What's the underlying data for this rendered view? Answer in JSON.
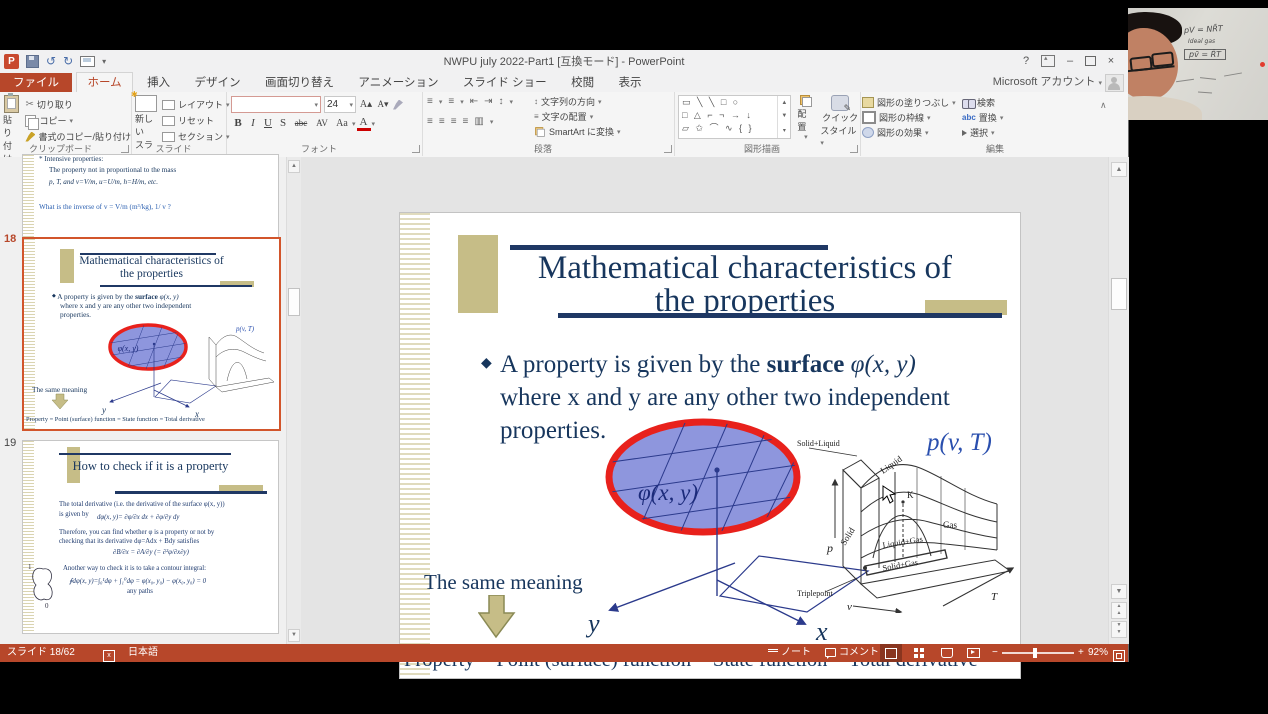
{
  "window": {
    "title": "NWPU july 2022-Part1 [互換モード] - PowerPoint",
    "account": "Microsoft アカウント"
  },
  "icons": {
    "caret": "▾",
    "up": "▲",
    "down": "▼",
    "minus": "−",
    "plus": "+",
    "undo": "↺",
    "redo": "↻",
    "help": "?",
    "min": "–",
    "close": "×",
    "collapse": "∧",
    "cut": "✂",
    "bold": "B",
    "italic": "I",
    "underline": "U",
    "strike": "S",
    "abc": "abc",
    "av": "AV",
    "aa": "Aa",
    "fontcolor": "A",
    "grow": "A▴",
    "shrink": "A▾",
    "eq": "≡",
    "indent_l": "⇤",
    "indent_r": "⇥",
    "spacing": "↕",
    "columns": "▥",
    "dots": "⁞",
    "shapes_r1": "▭ ╲ ╲ □ ○",
    "shapes_r2": "□ △ ⌐ ¬ → ↓",
    "shapes_r3": "▱ ✩ ⌒ ∿ { }"
  },
  "tabs": [
    {
      "label": "ファイル"
    },
    {
      "label": "ホーム"
    },
    {
      "label": "挿入"
    },
    {
      "label": "デザイン"
    },
    {
      "label": "画面切り替え"
    },
    {
      "label": "アニメーション"
    },
    {
      "label": "スライド ショー"
    },
    {
      "label": "校閲"
    },
    {
      "label": "表示"
    }
  ],
  "ribbon": {
    "clipboard": {
      "label": "クリップボード",
      "paste": "貼り付け",
      "cut": "切り取り",
      "copy": "コピー",
      "format_painter": "書式のコピー/貼り付け"
    },
    "slides": {
      "label": "スライド",
      "new1": "新しい",
      "new2": "スライド",
      "layout": "レイアウト",
      "reset": "リセット",
      "section": "セクション"
    },
    "font": {
      "label": "フォント",
      "size": "24"
    },
    "paragraph": {
      "label": "段落",
      "direction": "文字列の方向",
      "align_text": "文字の配置",
      "smartart": "SmartArt に変換"
    },
    "drawing": {
      "label": "図形描画",
      "arrange": "配置",
      "quick1": "クイック",
      "quick2": "スタイル",
      "fill": "図形の塗りつぶし",
      "outline": "図形の枠線",
      "effects": "図形の効果"
    },
    "editing": {
      "label": "編集",
      "find": "検索",
      "replace": "置換",
      "select": "選択"
    }
  },
  "thumbnails": {
    "partial": {
      "l0": "* Intensive properties:",
      "l1": "The property not in proportional to the mass",
      "l2": "p, T, and v=V/m, u=U/m, h=H/m, etc.",
      "l3": "What is the inverse of v = V/m  (m³/kg), 1/ v ?"
    },
    "s18": {
      "number": "18"
    },
    "s19": {
      "number": "19",
      "title": "How to check if it is a property",
      "l1": "The total derivative (i.e. the derivative of the surface φ(x, y))",
      "l2": "is given by",
      "f1": "dφ(x, y)= ∂φ/∂x dx + ∂φ/∂y dy",
      "l3": "Therefore, you can find whether φ is a property or not by",
      "l4": "checking that its derivative   dφ=Adx + Bdy   satisfies",
      "f2": "∂B/∂x = ∂A/∂y (= ∂²φ/∂x∂y)",
      "l5": "Another way to check it is to take a contour integral:",
      "f3": "∮dφ(x, y)=∫₀¹dφ + ∫₁⁰dφ = φ(x₀, y₀) − φ(x₀, y₀) = 0",
      "f3b": "any paths",
      "c1": "1",
      "c0": "0"
    }
  },
  "slide": {
    "title1": "Mathematical characteristics of",
    "title2": "the properties",
    "bullet_glyph": "◆",
    "b1a": "A property is given by the ",
    "b1b": "surface",
    "b1c": " φ(x, y)",
    "b2": "where x and y are any other two independent",
    "b3": "properties.",
    "ellipse_label": "φ(x, y)",
    "same": "The same meaning",
    "x": "x",
    "y": "y",
    "bottom": "Property = Point (surface) function = State function = Total derivative",
    "pvt": {
      "label": "p(v, T)",
      "solid_liquid": "Solid+Liquid",
      "liquid": "Liquid",
      "k": "K",
      "gas": "Gas",
      "liquid_gas": "Liquid+Gas",
      "solid_gas": "Solid+Gas",
      "solid": "Solid",
      "p": "p",
      "triple": "Triplepoint",
      "v": "v",
      "t": "T"
    }
  },
  "statusbar": {
    "slide": "スライド 18/62",
    "lang": "日本語",
    "notes": "ノート",
    "comments": "コメント",
    "zoom": "92%"
  },
  "webcam": {
    "b1": "pV = NR̄T",
    "b2": "Ideal gas",
    "b3": "pv̄ = R̄T"
  },
  "colors": {
    "accent": "#b7472a",
    "slide_text": "#17365d",
    "tan": "#c6bd87",
    "ellipse_fill": "#8e96dd",
    "ellipse_stroke": "#e8211c",
    "selection": "#d2552b",
    "pvt_label": "#2a4fae"
  }
}
